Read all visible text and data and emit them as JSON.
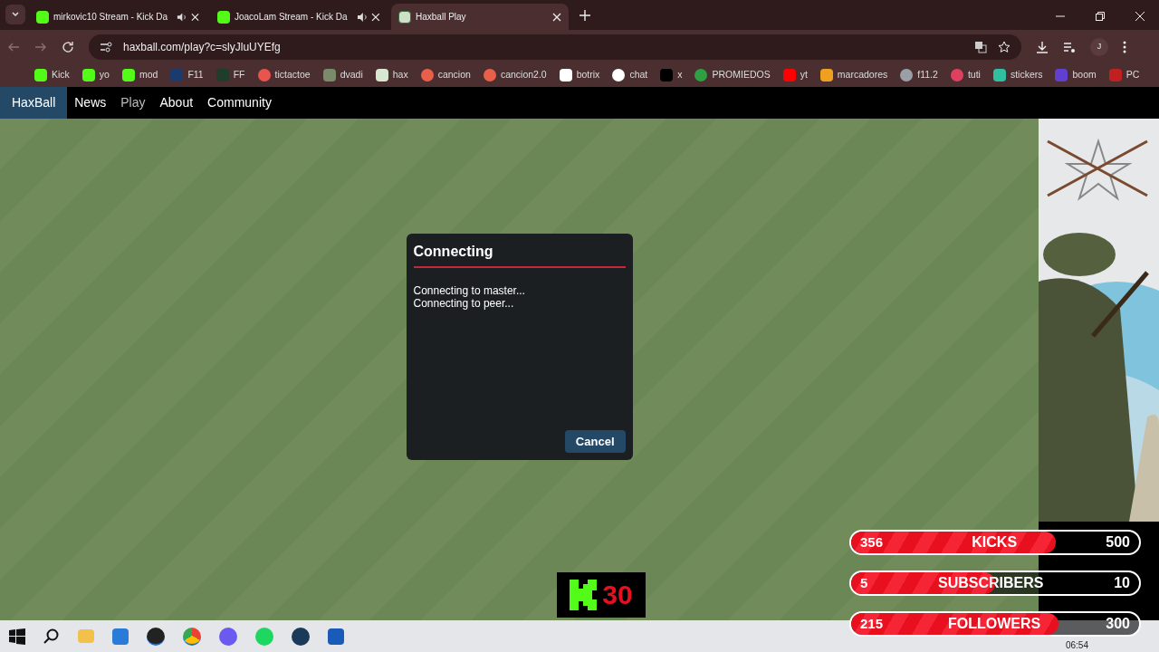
{
  "tabs": [
    {
      "title": "mirkovic10 Stream - Kick Da",
      "audio": true,
      "selected": false
    },
    {
      "title": "JoacoLam Stream - Kick Da",
      "audio": true,
      "selected": false
    },
    {
      "title": "Haxball Play",
      "audio": false,
      "selected": true
    }
  ],
  "address": "haxball.com/play?c=slyJluUYEfg",
  "profile_initial": "J",
  "bookmarks": [
    "Kick",
    "yo",
    "mod",
    "F11",
    "FF",
    "tictactoe",
    "dvadi",
    "hax",
    "cancion",
    "cancion2.0",
    "botrix",
    "chat",
    "x",
    "PROMIEDOS",
    "yt",
    "marcadores",
    "f11.2",
    "tuti",
    "stickers",
    "boom",
    "PC"
  ],
  "site_nav": {
    "logo": "HaxBall",
    "items": [
      {
        "label": "News",
        "selected": false
      },
      {
        "label": "Play",
        "selected": true
      },
      {
        "label": "About",
        "selected": false
      },
      {
        "label": "Community",
        "selected": false
      }
    ]
  },
  "dialog": {
    "title": "Connecting",
    "lines": [
      "Connecting to master...",
      "Connecting to peer..."
    ],
    "button": "Cancel"
  },
  "overlay": {
    "counter": "30",
    "goals": [
      {
        "current": "356",
        "label": "KICKS",
        "target": "500",
        "level": 0.71
      },
      {
        "current": "5",
        "label": "SUBSCRIBERS",
        "target": "10",
        "level": 0.5
      },
      {
        "current": "215",
        "label": "FOLLOWERS",
        "target": "300",
        "level": 0.72
      }
    ]
  },
  "taskbar": {
    "time": "06:54"
  }
}
